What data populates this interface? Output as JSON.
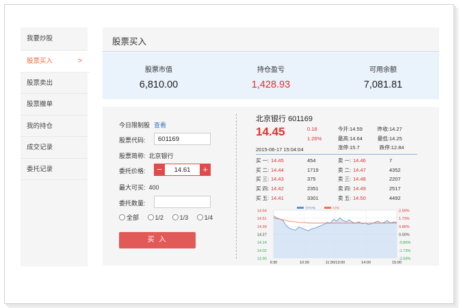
{
  "sidebar": {
    "items": [
      {
        "label": "我要炒股"
      },
      {
        "label": "股票买入",
        "active": true
      },
      {
        "label": "股票卖出"
      },
      {
        "label": "股票撤单"
      },
      {
        "label": "我的持仓"
      },
      {
        "label": "成交记录"
      },
      {
        "label": "委托记录"
      }
    ],
    "chevron": ">"
  },
  "header": {
    "title": "股票买入"
  },
  "summary": [
    {
      "label": "股票市值",
      "value": "6,810.00"
    },
    {
      "label": "持仓盈亏",
      "value": "1,428.93"
    },
    {
      "label": "可用余额",
      "value": "7,081.81"
    }
  ],
  "form": {
    "limit_label": "今日限制股",
    "limit_link": "查看",
    "code_label": "股票代码:",
    "code_value": "601169",
    "name_label": "股票简称:",
    "name_value": "北京银行",
    "price_label": "委托价格:",
    "price_value": "14.61",
    "minus": "−",
    "plus": "+",
    "max_label": "最大可买:",
    "max_value": "400",
    "qty_label": "委托数量:",
    "qty_value": "",
    "ratios": [
      "全部",
      "1/2",
      "1/3",
      "1/4"
    ],
    "buy_button": "买 入"
  },
  "quote": {
    "name": "北京银行",
    "code": "601169",
    "price": "14.45",
    "change": "0.18",
    "change_pct": "1.26%",
    "stats": [
      {
        "label": "今开:",
        "value": "14.59"
      },
      {
        "label": "昨收:",
        "value": "14.27"
      },
      {
        "label": "最高:",
        "value": "14.64"
      },
      {
        "label": "最低:",
        "value": "14.25"
      },
      {
        "label": "涨停:",
        "value": "15.7"
      },
      {
        "label": "跌停:",
        "value": "12.84"
      }
    ],
    "timestamp": "2015-06-17 15:04:04",
    "buy_orders": [
      {
        "label": "买 一:",
        "price": "14.45",
        "vol": "454"
      },
      {
        "label": "买 二:",
        "price": "14.44",
        "vol": "1719"
      },
      {
        "label": "买 三:",
        "price": "14.43",
        "vol": "375"
      },
      {
        "label": "买 四:",
        "price": "14.42",
        "vol": "2351"
      },
      {
        "label": "买 五:",
        "price": "14.41",
        "vol": "3301"
      }
    ],
    "sell_orders": [
      {
        "label": "卖 一:",
        "price": "14.46",
        "vol": "7"
      },
      {
        "label": "卖 二:",
        "price": "14.47",
        "vol": "4352"
      },
      {
        "label": "卖 三:",
        "price": "14.48",
        "vol": "2207"
      },
      {
        "label": "卖 四:",
        "price": "14.49",
        "vol": "2517"
      },
      {
        "label": "卖 五:",
        "price": "14.50",
        "vol": "4492"
      }
    ]
  },
  "chart_data": {
    "type": "line",
    "legend": [
      "分时线",
      "均线"
    ],
    "y_left_ticks": [
      "14.64",
      "14.51",
      "14.39",
      "14.27",
      "14.14",
      "14.02",
      "13.90"
    ],
    "y_right_ticks": [
      "2.59%",
      "1.73%",
      "0.86%",
      "0.00%",
      "-0.86%",
      "-1.73%",
      "-2.59%"
    ],
    "x_ticks": [
      "9:30",
      "10:30",
      "11:30/13:00",
      "14:00",
      "15:00"
    ],
    "ylim": [
      13.9,
      14.64
    ],
    "series": [
      {
        "name": "分时线",
        "values": [
          14.55,
          14.52,
          14.5,
          14.48,
          14.4,
          14.36,
          14.34,
          14.33,
          14.38,
          14.36,
          14.34,
          14.32,
          14.35,
          14.36,
          14.38,
          14.4,
          14.42,
          14.45,
          14.44,
          14.5,
          14.47,
          14.52,
          14.48,
          14.46,
          14.49,
          14.45,
          14.44,
          14.46,
          14.43,
          14.44,
          14.42,
          14.43,
          14.45,
          14.47,
          14.44,
          14.45,
          14.48,
          14.44,
          14.46,
          14.45
        ]
      },
      {
        "name": "均线",
        "values": [
          14.52,
          14.51,
          14.5,
          14.49,
          14.48,
          14.47,
          14.46,
          14.46,
          14.45,
          14.45,
          14.45,
          14.44,
          14.44,
          14.44,
          14.44,
          14.44,
          14.44,
          14.44,
          14.44,
          14.44,
          14.44,
          14.44,
          14.44,
          14.44,
          14.44,
          14.44,
          14.44,
          14.44,
          14.44,
          14.44,
          14.44,
          14.44,
          14.44,
          14.44,
          14.44,
          14.44,
          14.44,
          14.44,
          14.44,
          14.44
        ]
      }
    ]
  },
  "colors": {
    "accent": "#ec6a3c",
    "up": "#e0312f",
    "down": "#2ea84f",
    "line": "#5b8fd1",
    "avg": "#e8734a"
  }
}
